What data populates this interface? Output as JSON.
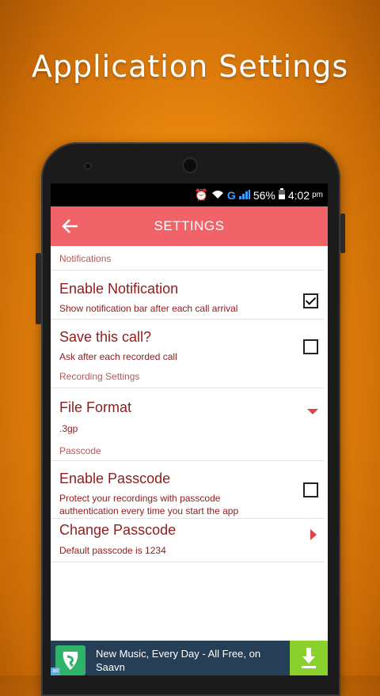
{
  "promo": {
    "title": "Application Settings"
  },
  "status_bar": {
    "network": "G",
    "battery": "56%",
    "time": "4:02",
    "ampm": "pm"
  },
  "app_bar": {
    "title": "SETTINGS"
  },
  "sections": {
    "notifications": "Notifications",
    "recording": "Recording Settings",
    "passcode": "Passcode"
  },
  "items": {
    "enable_notification": {
      "title": "Enable Notification",
      "summary": "Show notification bar after each call arrival",
      "checked": true
    },
    "save_call": {
      "title": "Save this call?",
      "summary": "Ask after each recorded call",
      "checked": false
    },
    "file_format": {
      "title": "File Format",
      "value": ".3gp"
    },
    "enable_passcode": {
      "title": "Enable Passcode",
      "summary_line1": "Protect your recordings with  passcode",
      "summary_line2": "authentication every time you start the app",
      "checked": false
    },
    "change_passcode": {
      "title": "Change Passcode",
      "summary": "Default passcode is 1234"
    }
  },
  "ad": {
    "line1": "New Music, Every Day - All Free, on",
    "line2": "Saavn",
    "badge": "ad"
  },
  "colors": {
    "app_bar": "#f06469",
    "text": "#8e1c1c",
    "section": "#b25a5a",
    "background": "#e8850e",
    "ad_button": "#8bd12e"
  },
  "icons": [
    "back-arrow-icon",
    "alarm-icon",
    "wifi-icon",
    "signal-icon",
    "battery-icon",
    "dropdown-icon",
    "chevron-right-icon",
    "saavn-logo-icon",
    "download-icon"
  ]
}
